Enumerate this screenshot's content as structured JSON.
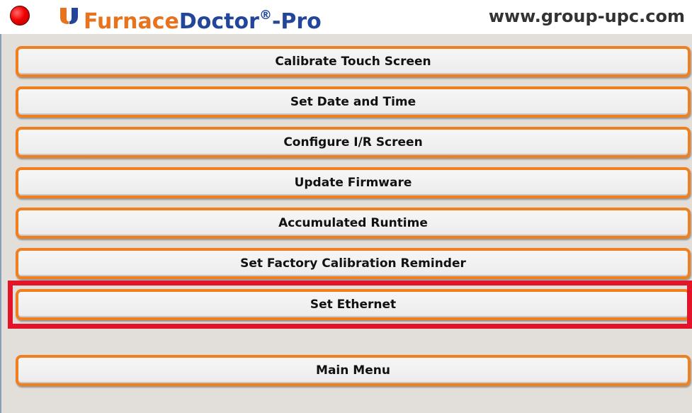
{
  "header": {
    "brand_part1": "Furnace",
    "brand_part2": "Doctor",
    "brand_reg": "®",
    "brand_part3": "-Pro",
    "website": "www.group-upc.com",
    "colors": {
      "brand_orange": "#e8731f",
      "brand_blue": "#24469a",
      "status_red": "#f20000"
    }
  },
  "menu": {
    "items": [
      {
        "label": "Calibrate Touch Screen"
      },
      {
        "label": "Set Date and Time"
      },
      {
        "label": "Configure I/R Screen"
      },
      {
        "label": "Update Firmware"
      },
      {
        "label": "Accumulated Runtime"
      },
      {
        "label": "Set Factory Calibration Reminder"
      },
      {
        "label": "Set Ethernet",
        "highlighted": true
      }
    ],
    "main_menu_label": "Main Menu",
    "highlight_color": "#e3142a",
    "button_border_color": "#ef7f1f"
  }
}
